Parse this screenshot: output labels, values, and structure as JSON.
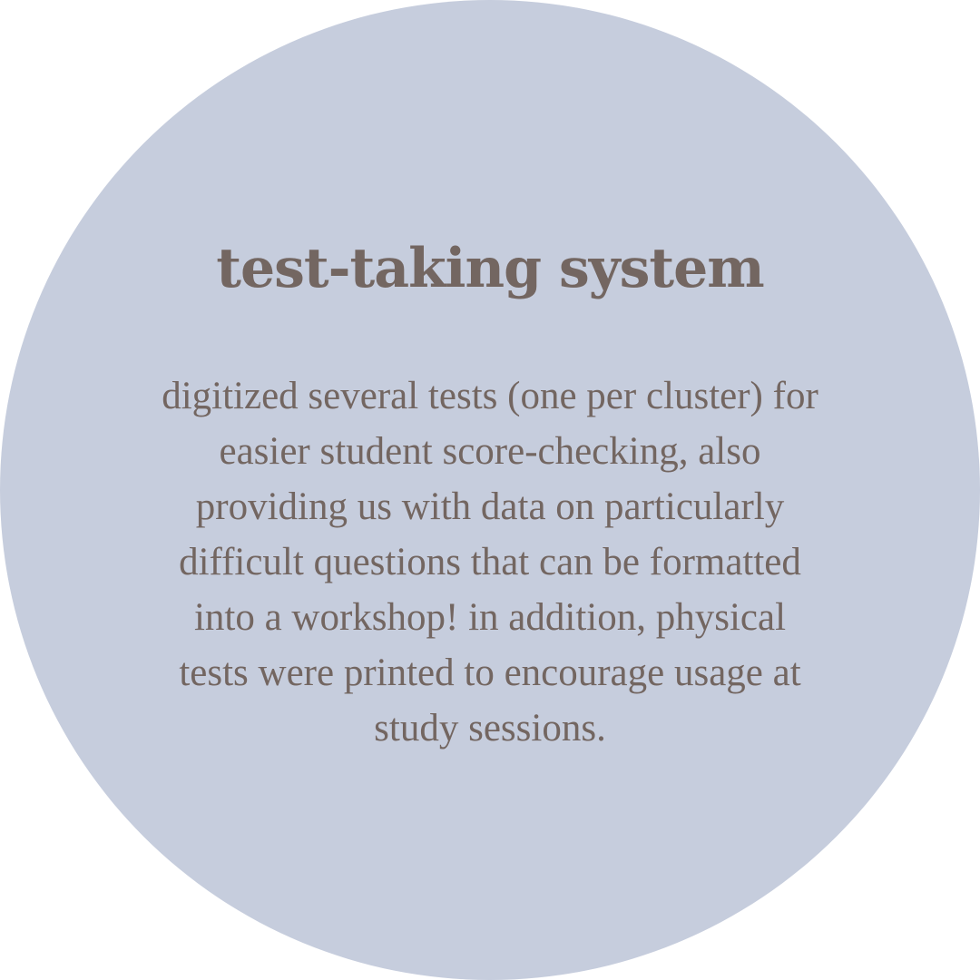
{
  "card": {
    "background_color": "#c6cddd",
    "text_color": "#736661",
    "title": "test-taking system",
    "body_lines": [
      "digitized several tests (one per cluster) for",
      "easier student score-checking, also",
      "providing us with data on particularly",
      "difficult questions that can be formatted",
      "into a workshop! in addition, physical",
      "tests were printed to encourage usage at",
      "study sessions."
    ]
  }
}
